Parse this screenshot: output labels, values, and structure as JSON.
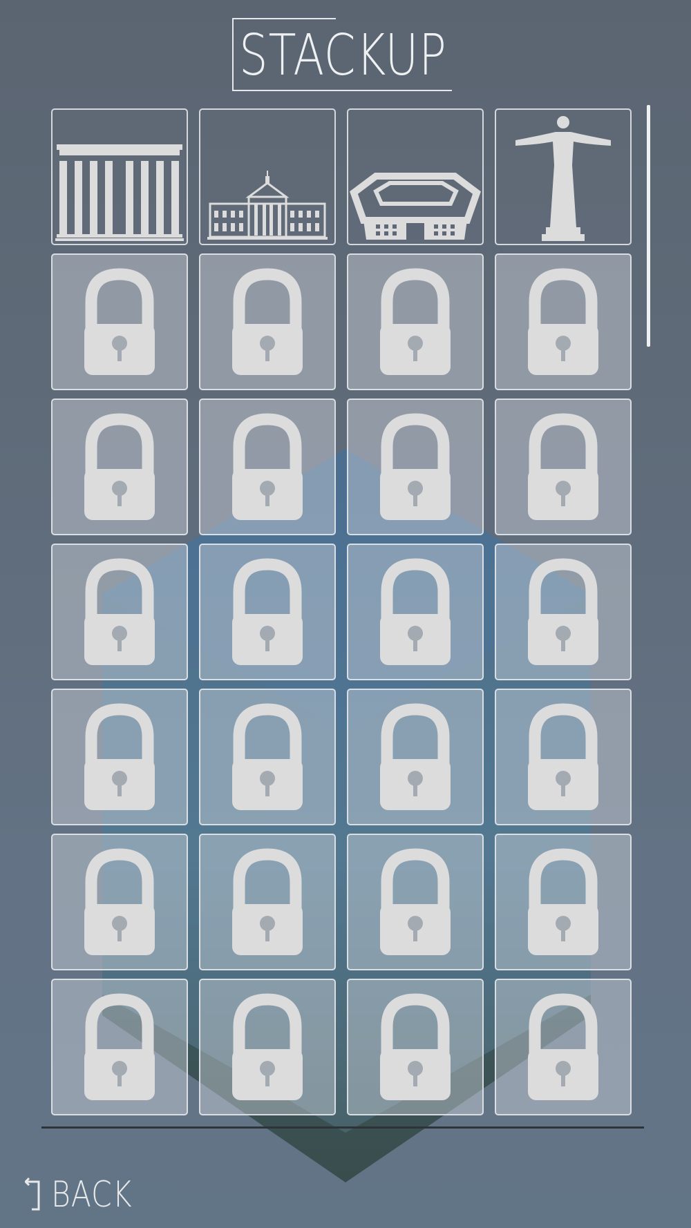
{
  "header": {
    "title": "STACKUP"
  },
  "levels": [
    {
      "status": "unlocked",
      "icon": "parthenon-icon"
    },
    {
      "status": "unlocked",
      "icon": "white-house-icon"
    },
    {
      "status": "unlocked",
      "icon": "pentagon-icon"
    },
    {
      "status": "unlocked",
      "icon": "christ-the-redeemer-icon"
    },
    {
      "status": "locked",
      "icon": "lock-icon"
    },
    {
      "status": "locked",
      "icon": "lock-icon"
    },
    {
      "status": "locked",
      "icon": "lock-icon"
    },
    {
      "status": "locked",
      "icon": "lock-icon"
    },
    {
      "status": "locked",
      "icon": "lock-icon"
    },
    {
      "status": "locked",
      "icon": "lock-icon"
    },
    {
      "status": "locked",
      "icon": "lock-icon"
    },
    {
      "status": "locked",
      "icon": "lock-icon"
    },
    {
      "status": "locked",
      "icon": "lock-icon"
    },
    {
      "status": "locked",
      "icon": "lock-icon"
    },
    {
      "status": "locked",
      "icon": "lock-icon"
    },
    {
      "status": "locked",
      "icon": "lock-icon"
    },
    {
      "status": "locked",
      "icon": "lock-icon"
    },
    {
      "status": "locked",
      "icon": "lock-icon"
    },
    {
      "status": "locked",
      "icon": "lock-icon"
    },
    {
      "status": "locked",
      "icon": "lock-icon"
    },
    {
      "status": "locked",
      "icon": "lock-icon"
    },
    {
      "status": "locked",
      "icon": "lock-icon"
    },
    {
      "status": "locked",
      "icon": "lock-icon"
    },
    {
      "status": "locked",
      "icon": "lock-icon"
    },
    {
      "status": "locked",
      "icon": "lock-icon"
    },
    {
      "status": "locked",
      "icon": "lock-icon"
    },
    {
      "status": "locked",
      "icon": "lock-icon"
    },
    {
      "status": "locked",
      "icon": "lock-icon"
    }
  ],
  "footer": {
    "back_label": "BACK",
    "back_icon": "return-arrow-icon"
  },
  "colors": {
    "background_top": "#5b6572",
    "background_bottom": "#627587",
    "tile_border": "#e2e6ea",
    "icon_fill": "#dcdcdc",
    "text": "#eef0f2"
  }
}
